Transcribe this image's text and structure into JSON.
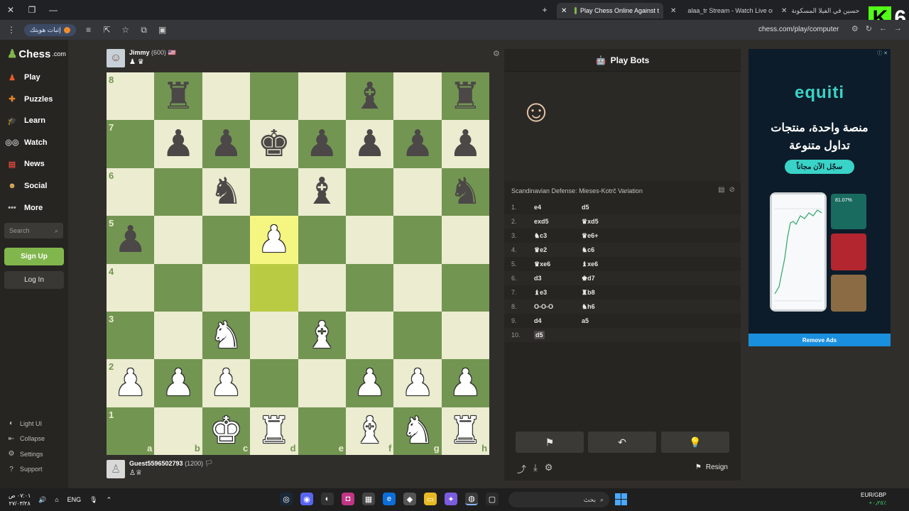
{
  "browser": {
    "tabs": [
      {
        "title": "Play Chess Online Against t",
        "active": true
      },
      {
        "title": "alaa_tr Stream - Watch Live on",
        "active": false
      },
      {
        "title": "حسين في الفيلا المسكونة",
        "active": false
      }
    ],
    "verify_label": "إثبات هويتك",
    "url": "chess.com/play/computer",
    "brand_number": "6"
  },
  "sidebar": {
    "logo": "Chess",
    "logo_suffix": ".com",
    "nav": [
      {
        "label": "Play",
        "icon": "play-icon",
        "color": "#e85c28"
      },
      {
        "label": "Puzzles",
        "icon": "puzzle-icon",
        "color": "#e8832b"
      },
      {
        "label": "Learn",
        "icon": "learn-icon",
        "color": "#3a9ad9"
      },
      {
        "label": "Watch",
        "icon": "binoculars-icon",
        "color": "#bbb"
      },
      {
        "label": "News",
        "icon": "news-icon",
        "color": "#d8453a"
      },
      {
        "label": "Social",
        "icon": "social-icon",
        "color": "#e0b060"
      },
      {
        "label": "More",
        "icon": "more-icon",
        "color": "#bbb"
      }
    ],
    "search_placeholder": "Search",
    "signup": "Sign Up",
    "login": "Log In",
    "footer": [
      {
        "label": "Light UI",
        "icon": "contrast-icon"
      },
      {
        "label": "Collapse",
        "icon": "collapse-icon"
      },
      {
        "label": "Settings",
        "icon": "settings-icon"
      },
      {
        "label": "Support",
        "icon": "help-icon"
      }
    ]
  },
  "top_player": {
    "name": "Jimmy",
    "rating": "(600)",
    "flag": "🇺🇸",
    "captured": "♟ ♛"
  },
  "bottom_player": {
    "name": "Guest5596502793",
    "rating": "(1200)",
    "flag": "🏳",
    "captured": "♙♕"
  },
  "board": {
    "ranks": [
      "8",
      "7",
      "6",
      "5",
      "4",
      "3",
      "2",
      "1"
    ],
    "files": [
      "a",
      "b",
      "c",
      "d",
      "e",
      "f",
      "g",
      "h"
    ],
    "highlight": [
      "d5",
      "d4"
    ],
    "rows": [
      [
        "",
        "bR",
        "",
        "",
        "",
        "bB",
        "",
        "bR"
      ],
      [
        "",
        "bP",
        "bP",
        "bK",
        "bP",
        "bP",
        "bP",
        "bP"
      ],
      [
        "",
        "",
        "bN",
        "",
        "bB",
        "",
        "",
        "bN"
      ],
      [
        "bP",
        "",
        "",
        "wP",
        "",
        "",
        "",
        ""
      ],
      [
        "",
        "",
        "",
        "",
        "",
        "",
        "",
        ""
      ],
      [
        "",
        "",
        "wN",
        "",
        "wB",
        "",
        "",
        ""
      ],
      [
        "wP",
        "wP",
        "wP",
        "",
        "",
        "wP",
        "wP",
        "wP"
      ],
      [
        "",
        "",
        "wK",
        "wR",
        "",
        "wB",
        "wN",
        "wR"
      ]
    ]
  },
  "panel": {
    "title": "Play Bots",
    "opening": "Scandinavian Defense: Mieses-Kotrč Variation",
    "moves": [
      {
        "n": "1.",
        "w": "e4",
        "b": "d5"
      },
      {
        "n": "2.",
        "w": "exd5",
        "b": "♛xd5"
      },
      {
        "n": "3.",
        "w": "♞c3",
        "b": "♛e6+"
      },
      {
        "n": "4.",
        "w": "♛e2",
        "b": "♞c6"
      },
      {
        "n": "5.",
        "w": "♛xe6",
        "b": "♝xe6"
      },
      {
        "n": "6.",
        "w": "d3",
        "b": "♚d7"
      },
      {
        "n": "7.",
        "w": "♝e3",
        "b": "♜b8"
      },
      {
        "n": "8.",
        "w": "O-O-O",
        "b": "♞h6"
      },
      {
        "n": "9.",
        "w": "d4",
        "b": "a5"
      },
      {
        "n": "10.",
        "w": "d5",
        "b": ""
      }
    ],
    "resign": "Resign"
  },
  "ad": {
    "logo": "equiti",
    "line1": "منصة واحدة، منتجات",
    "line2": "تداول متنوعة",
    "cta": "سجّل الآن مجاناً",
    "stat": "81.07%",
    "remove": "Remove Ads"
  },
  "taskbar": {
    "time": "٠٧:٠١ ص",
    "date": "٢٧/٠٣/٢٨",
    "lang": "ENG",
    "search": "بحث",
    "fx_pair": "EUR/GBP",
    "fx_change": "+٠٫٢٥٪"
  }
}
